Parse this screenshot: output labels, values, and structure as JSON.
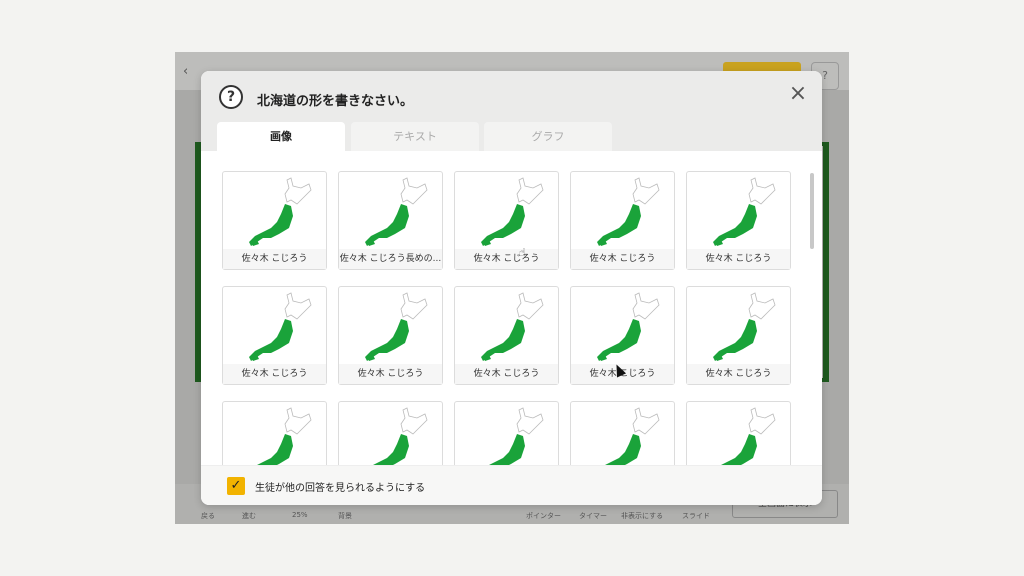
{
  "background_app": {
    "breadcrumb": "",
    "bottom_labels": [
      "戻る",
      "進む",
      "25%",
      "背景",
      "ポインター",
      "タイマー",
      "非表示にする",
      "スライド"
    ],
    "fullscreen_label": "全画面に表示"
  },
  "modal": {
    "question": "北海道の形を書きなさい。",
    "tabs": [
      {
        "label": "画像",
        "active": true
      },
      {
        "label": "テキスト",
        "active": false
      },
      {
        "label": "グラフ",
        "active": false
      }
    ],
    "cards": [
      {
        "name": "佐々木 こじろう"
      },
      {
        "name": "佐々木 こじろう長めの..."
      },
      {
        "name": "佐々木 こじろう"
      },
      {
        "name": "佐々木 こじろう"
      },
      {
        "name": "佐々木 こじろう"
      },
      {
        "name": "佐々木 こじろう"
      },
      {
        "name": "佐々木 こじろう"
      },
      {
        "name": "佐々木 こじろう"
      },
      {
        "name": "佐々木 こじろう"
      },
      {
        "name": "佐々木 こじろう"
      },
      {
        "name": ""
      },
      {
        "name": ""
      },
      {
        "name": ""
      },
      {
        "name": ""
      },
      {
        "name": ""
      }
    ],
    "footer": {
      "checkbox_checked": true,
      "checkbox_label": "生徒が他の回答を見られるようにする"
    }
  },
  "colors": {
    "accent_yellow": "#f2b300",
    "map_green": "#1aa33a"
  }
}
